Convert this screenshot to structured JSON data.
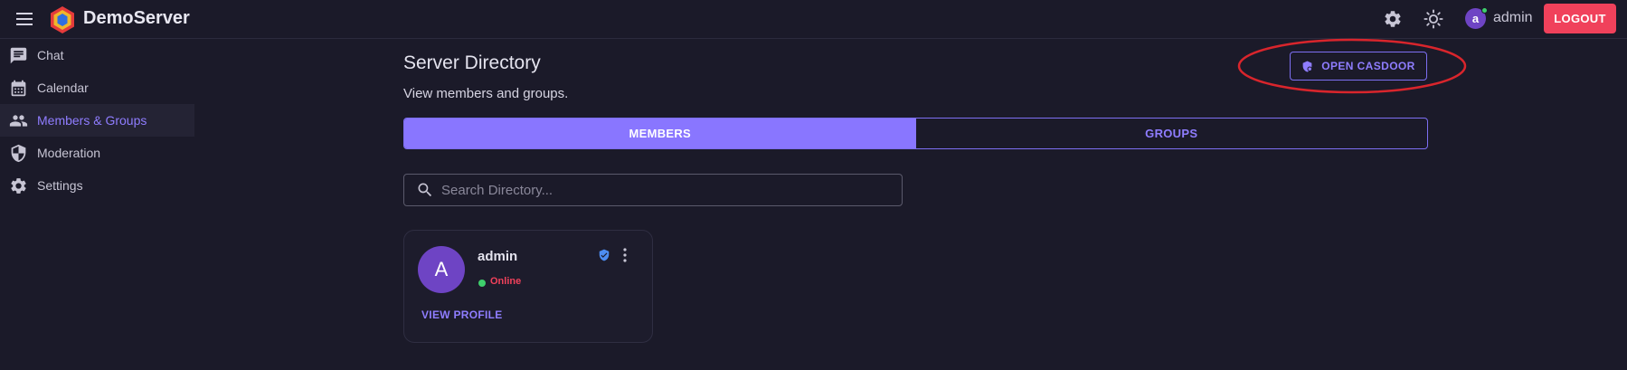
{
  "app": {
    "title": "DemoServer"
  },
  "header": {
    "user_avatar_letter": "a",
    "user_name": "admin",
    "logout_label": "LOGOUT"
  },
  "sidebar": {
    "items": [
      {
        "label": "Chat",
        "icon": "chat-icon"
      },
      {
        "label": "Calendar",
        "icon": "calendar-icon"
      },
      {
        "label": "Members & Groups",
        "icon": "people-icon",
        "active": true
      },
      {
        "label": "Moderation",
        "icon": "shield-icon"
      },
      {
        "label": "Settings",
        "icon": "gear-icon"
      }
    ]
  },
  "main": {
    "title": "Server Directory",
    "subtitle": "View members and groups.",
    "open_casdoor_label": "OPEN CASDOOR",
    "tabs": [
      {
        "label": "MEMBERS",
        "selected": true
      },
      {
        "label": "GROUPS",
        "selected": false
      }
    ],
    "search": {
      "placeholder": "Search Directory...",
      "value": ""
    },
    "members": [
      {
        "avatar_letter": "A",
        "name": "admin",
        "status": "Online",
        "view_profile_label": "VIEW PROFILE"
      }
    ]
  },
  "colors": {
    "background": "#1b1a29",
    "accent": "#8976ff",
    "logout": "#f0415b",
    "online": "#3ecf6c",
    "status_text": "#f0415b",
    "annotation": "#d9252c"
  }
}
